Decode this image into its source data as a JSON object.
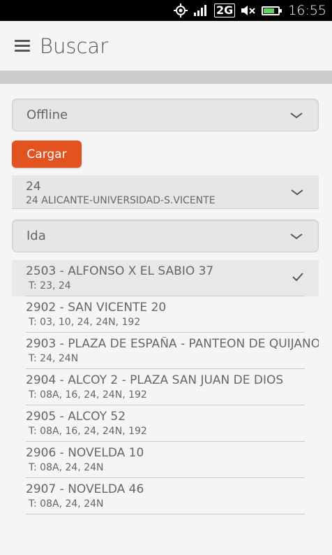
{
  "status_bar": {
    "network_type": "2G",
    "time": "16:55"
  },
  "header": {
    "title": "Buscar"
  },
  "source_select": {
    "value": "Offline"
  },
  "load_button": {
    "label": "Cargar"
  },
  "line_select": {
    "number": "24",
    "name": "24 ALICANTE-UNIVERSIDAD-S.VICENTE"
  },
  "direction_select": {
    "value": "Ida"
  },
  "stops": [
    {
      "name": "2503 - ALFONSO X EL SABIO 37",
      "lines": "T: 23, 24",
      "selected": true
    },
    {
      "name": "2902 - SAN VICENTE 20",
      "lines": "T: 03, 10, 24, 24N, 192"
    },
    {
      "name": "2903 - PLAZA DE ESPAÑA - PANTEON DE QUIJANO",
      "lines": "T: 24, 24N"
    },
    {
      "name": "2904 - ALCOY 2 - PLAZA SAN JUAN DE DIOS",
      "lines": "T: 08A, 16, 24, 24N, 192"
    },
    {
      "name": "2905 - ALCOY 52",
      "lines": "T: 08A, 16, 24, 24N, 192"
    },
    {
      "name": "2906 - NOVELDA 10",
      "lines": "T: 08A, 24, 24N"
    },
    {
      "name": "2907 - NOVELDA 46",
      "lines": "T: 08A, 24, 24N"
    }
  ],
  "colors": {
    "accent": "#e2531f",
    "battery": "#5ed45e"
  }
}
